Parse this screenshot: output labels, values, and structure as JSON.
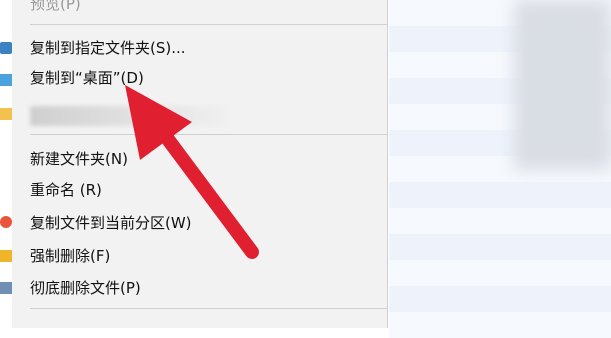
{
  "menu": {
    "items": [
      {
        "id": "cut",
        "label": "预览(P)"
      },
      {
        "id": "copy-to-folder",
        "label": "复制到指定文件夹(S)..."
      },
      {
        "id": "copy-to-desktop",
        "label": "复制到“桌面”(D)"
      },
      {
        "id": "new-folder",
        "label": "新建文件夹(N)"
      },
      {
        "id": "rename",
        "label": "重命名 (R)"
      },
      {
        "id": "copy-to-partition",
        "label": "复制文件到当前分区(W)"
      },
      {
        "id": "force-delete",
        "label": "强制删除(F)"
      },
      {
        "id": "shred",
        "label": "彻底删除文件(P)"
      }
    ]
  },
  "colors": {
    "arrow": "#e02030",
    "menu_bg": "#f2f2f2",
    "right_pane": "#eef3fb"
  },
  "icons": [
    "folder-icon",
    "desktop-icon",
    "chrome-icon",
    "lock-icon",
    "trash-icon"
  ]
}
